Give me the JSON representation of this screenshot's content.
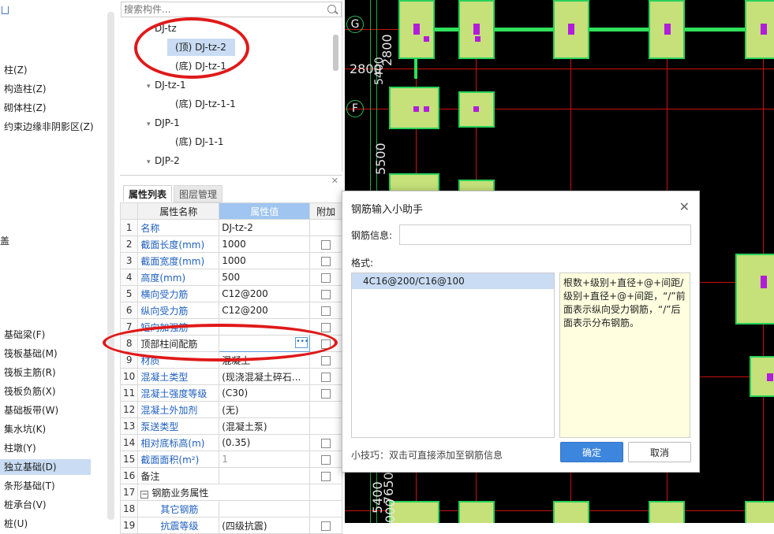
{
  "left_nav": {
    "items": [
      {
        "label": "柱(Z)"
      },
      {
        "label": "构造柱(Z)"
      },
      {
        "label": "砌体柱(Z)"
      },
      {
        "label": "约束边缘非阴影区(Z)"
      },
      {
        "label": "盖"
      },
      {
        "label": "基础梁(F)"
      },
      {
        "label": "筏板基础(M)"
      },
      {
        "label": "筏板主筋(R)"
      },
      {
        "label": "筏板负筋(X)"
      },
      {
        "label": "基础板带(W)"
      },
      {
        "label": "集水坑(K)"
      },
      {
        "label": "柱墩(Y)"
      },
      {
        "label": "独立基础(D)"
      },
      {
        "label": "条形基础(T)"
      },
      {
        "label": "桩承台(V)"
      },
      {
        "label": "桩(U)"
      }
    ]
  },
  "tree": {
    "search_placeholder": "搜索构件...",
    "rows": [
      {
        "label": "DJ-tz",
        "arrow": ""
      },
      {
        "label": "(顶)  DJ-tz-2",
        "arrow": ""
      },
      {
        "label": "(底)  DJ-tz-1",
        "arrow": ""
      },
      {
        "label": "DJ-tz-1",
        "arrow": "▾"
      },
      {
        "label": "(底)  DJ-tz-1-1",
        "arrow": ""
      },
      {
        "label": "DJP-1",
        "arrow": "▾"
      },
      {
        "label": "(底)  DJ-1-1",
        "arrow": ""
      },
      {
        "label": "DJP-2",
        "arrow": "▾"
      }
    ]
  },
  "props": {
    "tab_active": "属性列表",
    "tab_inactive": "图层管理",
    "headers": {
      "name": "属性名称",
      "value": "属性值",
      "extra": "附加"
    },
    "rows": [
      {
        "num": "1",
        "name": "名称",
        "value": "DJ-tz-2",
        "chk": false
      },
      {
        "num": "2",
        "name": "截面长度(mm)",
        "value": "1000",
        "chk": true
      },
      {
        "num": "3",
        "name": "截面宽度(mm)",
        "value": "1000",
        "chk": true
      },
      {
        "num": "4",
        "name": "高度(mm)",
        "value": "500",
        "chk": true
      },
      {
        "num": "5",
        "name": "横向受力筋",
        "value": "C12@200",
        "chk": true
      },
      {
        "num": "6",
        "name": "纵向受力筋",
        "value": "C12@200",
        "chk": true
      },
      {
        "num": "7",
        "name": "短向加强筋",
        "value": "",
        "chk": true
      },
      {
        "num": "8",
        "name": "顶部柱间配筋",
        "value": "",
        "chk": true
      },
      {
        "num": "9",
        "name": "材质",
        "value": "混凝土",
        "chk": true
      },
      {
        "num": "10",
        "name": "混凝土类型",
        "value": "(现浇混凝土碎石...",
        "chk": true
      },
      {
        "num": "11",
        "name": "混凝土强度等级",
        "value": "(C30)",
        "chk": true
      },
      {
        "num": "12",
        "name": "混凝土外加剂",
        "value": "(无)",
        "chk": false
      },
      {
        "num": "13",
        "name": "泵送类型",
        "value": "(混凝土泵)",
        "chk": false
      },
      {
        "num": "14",
        "name": "相对底标高(m)",
        "value": "(0.35)",
        "chk": true
      },
      {
        "num": "15",
        "name": "截面面积(m²)",
        "value": "1",
        "chk": true
      },
      {
        "num": "16",
        "name": "备注",
        "value": "",
        "chk": true
      },
      {
        "num": "17",
        "name": "钢筋业务属性",
        "value": "",
        "chk": false
      },
      {
        "num": "18",
        "name": "其它钢筋",
        "value": "",
        "chk": false
      },
      {
        "num": "19",
        "name": "抗震等级",
        "value": "(四级抗震)",
        "chk": true
      }
    ]
  },
  "cad": {
    "axis_g": "G",
    "axis_f": "F",
    "dims": [
      "2800",
      "2800",
      "5400",
      "5500",
      "7650",
      "5400",
      "000"
    ]
  },
  "dialog": {
    "title": "钢筋输入小助手",
    "info_label": "钢筋信息:",
    "info_value": "",
    "format_label": "格式:",
    "list_items": [
      "4C16@200/C16@100"
    ],
    "description": "根数+级别+直径+@+间距/级别+直径+@+间距，“/”前面表示纵向受力钢筋，“/”后面表示分布钢筋。",
    "tip": "小技巧：双击可直接添加至钢筋信息",
    "ok_label": "确定",
    "cancel_label": "取消"
  },
  "colors": {
    "accent": "#3d86de",
    "selection": "#c9dcf3",
    "header_value": "#9fc5f0",
    "annotation": "#e01919",
    "cad_pad_fill": "#c6e07a",
    "cad_pad_border": "#28d25a"
  }
}
